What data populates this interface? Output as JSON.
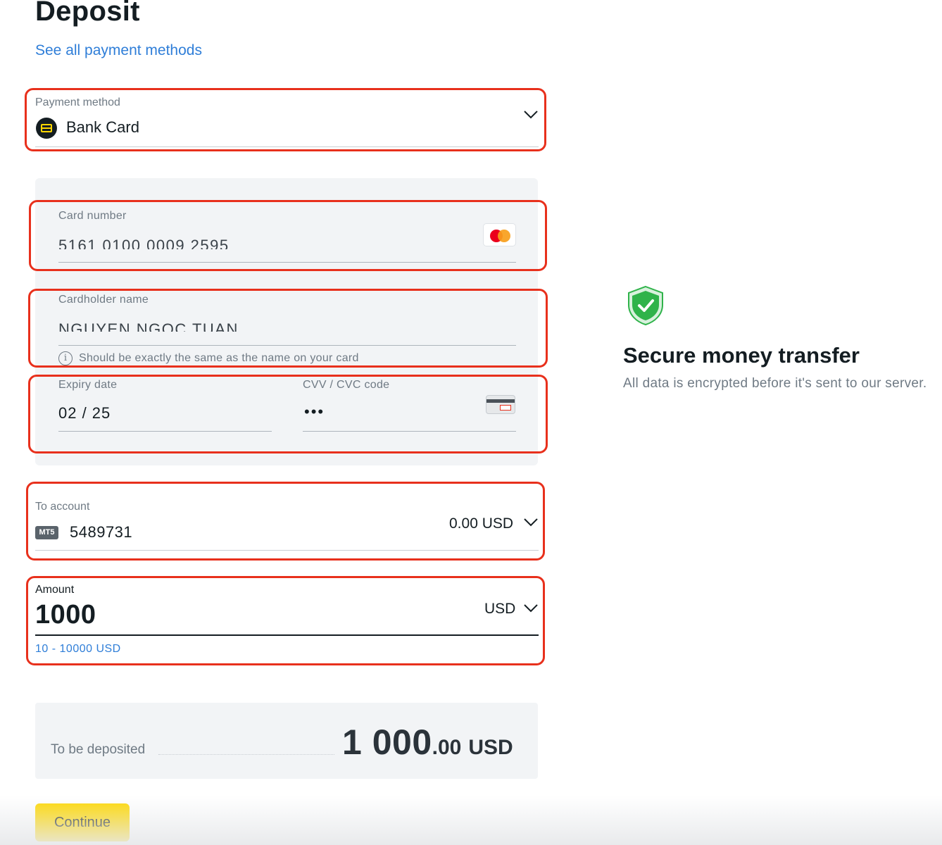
{
  "header": {
    "title": "Deposit",
    "see_all_link": "See all payment methods"
  },
  "payment_method": {
    "label": "Payment method",
    "value": "Bank Card",
    "icon": "bank-card-icon"
  },
  "card_form": {
    "card_number": {
      "label": "Card number",
      "value": "5161 0100 0009 2595",
      "brand_icon": "mastercard-icon"
    },
    "cardholder": {
      "label": "Cardholder name",
      "value": "NGUYEN NGOC TUAN",
      "hint": "Should be exactly the same as the name on your card"
    },
    "expiry": {
      "label": "Expiry date",
      "value": "02 / 25"
    },
    "cvv": {
      "label": "CVV / CVC code",
      "value": "•••",
      "icon": "card-back-icon"
    }
  },
  "to_account": {
    "label": "To account",
    "badge": "MT5",
    "number": "5489731",
    "balance": "0.00 USD"
  },
  "amount": {
    "label": "Amount",
    "value": "1000",
    "currency": "USD",
    "range": "10 - 10000 USD"
  },
  "summary": {
    "label": "To be deposited",
    "amount_main": "1 000",
    "amount_decimals": ".00",
    "currency": "USD"
  },
  "actions": {
    "continue_label": "Continue"
  },
  "secure": {
    "title": "Secure money transfer",
    "description": "All data is encrypted before it's sent to our server.",
    "icon": "shield-check-icon"
  },
  "colors": {
    "accent_yellow": "#ffd800",
    "link_blue": "#2f7ed8",
    "highlight_red": "#e8301c",
    "shield_green": "#2fb34a"
  }
}
